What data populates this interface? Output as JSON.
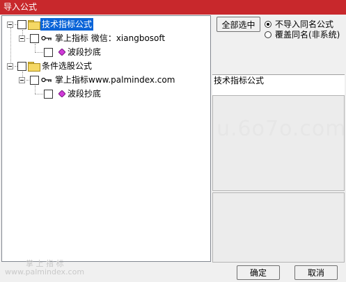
{
  "window": {
    "title": "导入公式"
  },
  "tree": {
    "nodes": [
      {
        "label": "技术指标公式"
      },
      {
        "label": "掌上指标 微信：xiangbosoft"
      },
      {
        "label": "波段抄底"
      },
      {
        "label": "条件选股公式"
      },
      {
        "label": "掌上指标www.palmindex.com"
      },
      {
        "label": "波段抄底"
      }
    ]
  },
  "select_all_label": "全部选中",
  "options": [
    {
      "label": "不导入同名公式",
      "checked": true
    },
    {
      "label": "覆盖同名(非系统)",
      "checked": false
    }
  ],
  "detail_label": "技术指标公式",
  "buttons": {
    "ok": "确定",
    "cancel": "取消"
  },
  "watermark": {
    "main": "u.6o7o.com",
    "line1": "掌 上 指 标",
    "line2": "www.palmindex.com"
  },
  "colors": {
    "titlebar": "#c8282c",
    "selection": "#0a64d8"
  }
}
